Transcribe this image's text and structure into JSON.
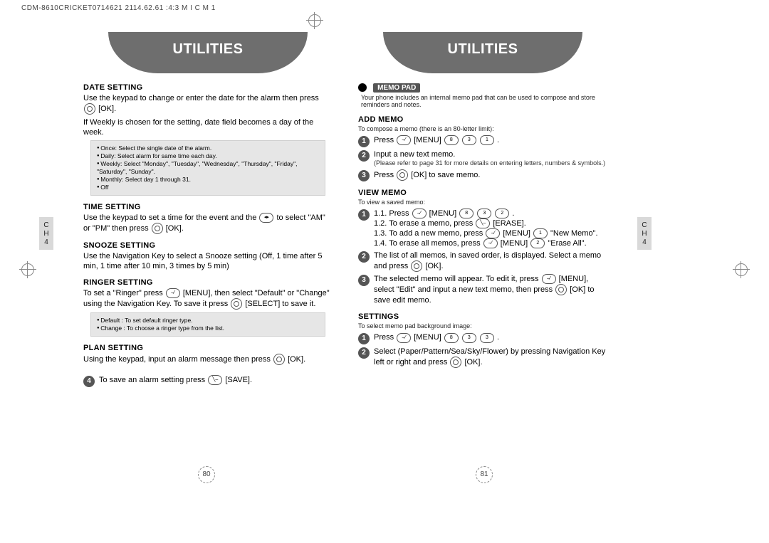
{
  "header_line": "CDM-8610CRICKET0714621  2114.62.61  :4:3  M I C M 1",
  "chapter_tab": {
    "line1": "C",
    "line2": "H",
    "line3": "4"
  },
  "left_page": {
    "banner": "UTILITIES",
    "sections": {
      "date": {
        "title": "DATE SETTING",
        "p1": "Use the keypad to change or enter the date for the alarm then press",
        "p1_after": "[OK].",
        "p2": "If Weekly is chosen for the setting, date field becomes a day of the week.",
        "notes": [
          "Once: Select the single date of the alarm.",
          "Daily: Select alarm for same time each day.",
          "Weekly: Select \"Monday\", \"Tuesday\", \"Wednesday\", \"Thursday\", \"Friday\", \"Saturday\", \"Sunday\".",
          "Monthly: Select day 1 through 31.",
          "Off"
        ]
      },
      "time": {
        "title": "TIME SETTING",
        "p1a": "Use the keypad to set a time for the event and the",
        "p1b": "to select \"AM\" or \"PM\" then press",
        "p1c": "[OK]."
      },
      "snooze": {
        "title": "SNOOZE SETTING",
        "p1": "Use the Navigation Key to select a Snooze setting (Off, 1 time after 5 min, 1 time after 10 min, 3 times by 5 min)"
      },
      "ringer": {
        "title": "RINGER SETTING",
        "p1a": "To set a \"Ringer\" press",
        "p1b": "[MENU], then select \"Default\" or \"Change\" using the Navigation Key. To save it press",
        "p1c": "[SELECT] to save it.",
        "notes": [
          "Default : To set default ringer type.",
          "Change : To choose a ringer type from the list."
        ]
      },
      "plan": {
        "title": "PLAN SETTING",
        "p1a": "Using the keypad, input an alarm message then press",
        "p1b": "[OK]."
      },
      "step4": "To save an alarm setting press",
      "step4_after": "[SAVE]."
    },
    "pagenum": "80"
  },
  "right_page": {
    "banner": "UTILITIES",
    "memopad_label": "MEMO PAD",
    "memopad_intro": "Your phone includes an internal memo pad that can be used to compose and store reminders and notes.",
    "add": {
      "title": "ADD MEMO",
      "note": "To compose a memo (there is an 80-letter limit):",
      "step1a": "Press",
      "step1b": "[MENU]",
      "keys1": [
        "8",
        "3",
        "1"
      ],
      "step1c": ".",
      "step2": "Input a new text memo.",
      "step2_sub": "(Please refer to page 31 for more details on entering letters, numbers & symbols.)",
      "step3a": "Press",
      "step3b": "[OK] to save memo."
    },
    "view": {
      "title": "VIEW MEMO",
      "note": "To view a saved memo:",
      "step1": {
        "l1a": "1.1. Press",
        "l1b": "[MENU]",
        "keys": [
          "8",
          "3",
          "2"
        ],
        "l1c": ".",
        "l2a": "1.2. To erase a memo, press",
        "l2b": "[ERASE].",
        "l3a": "1.3. To add a new memo, press",
        "l3b": "[MENU]",
        "l3key": "1",
        "l3c": "\"New Memo\".",
        "l4a": "1.4. To erase all memos, press",
        "l4b": "[MENU]",
        "l4key": "2",
        "l4c": "\"Erase All\"."
      },
      "step2": "The list of all memos, in saved order, is displayed. Select a memo and press",
      "step2_after": "[OK].",
      "step3a": "The selected memo will appear.  To edit it, press",
      "step3b": "[MENU], select \"Edit\" and input a new text memo, then press",
      "step3c": "[OK] to save edit memo."
    },
    "settings": {
      "title": "SETTINGS",
      "note": "To select memo pad background image:",
      "step1a": "Press",
      "step1b": "[MENU]",
      "keys": [
        "8",
        "3",
        "3"
      ],
      "step1c": ".",
      "step2a": "Select (Paper/Pattern/Sea/Sky/Flower) by pressing Navigation Key left or right and press",
      "step2b": "[OK]."
    },
    "pagenum": "81"
  }
}
